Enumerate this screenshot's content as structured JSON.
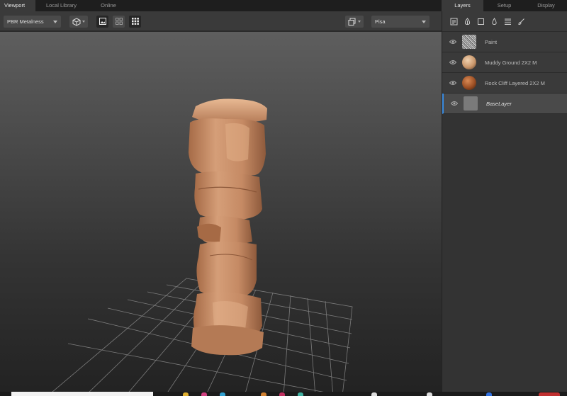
{
  "tabs": {
    "left": [
      {
        "label": "Viewport",
        "active": true
      },
      {
        "label": "Local Library",
        "active": false
      },
      {
        "label": "Online",
        "active": false
      }
    ],
    "right": [
      {
        "label": "Layers",
        "active": true
      },
      {
        "label": "Setup",
        "active": false
      },
      {
        "label": "Display",
        "active": false
      }
    ]
  },
  "toolbar": {
    "render_mode": "PBR Metalness",
    "environment": "Pisa",
    "icons": [
      "cube-view-icon",
      "image-view-icon",
      "tiles-view-icon",
      "grid-toggle-icon",
      "layers-stack-icon"
    ]
  },
  "layer_tools": [
    "properties-icon",
    "paint-fill-icon",
    "square-icon",
    "drop-icon",
    "adjust-icon",
    "brush-icon"
  ],
  "layers": [
    {
      "name": "Paint",
      "thumb": "noise",
      "selected": false
    },
    {
      "name": "Muddy Ground 2X2 M",
      "thumb": "sphere-tan",
      "selected": false
    },
    {
      "name": "Rock Cliff Layered 2X2 M",
      "thumb": "sphere-rust",
      "selected": false
    },
    {
      "name": "BaseLayer",
      "thumb": "flat-gray",
      "selected": true
    }
  ],
  "colors": {
    "accent": "#3a8be0",
    "rock": "#c9916a",
    "panel": "#333333"
  }
}
